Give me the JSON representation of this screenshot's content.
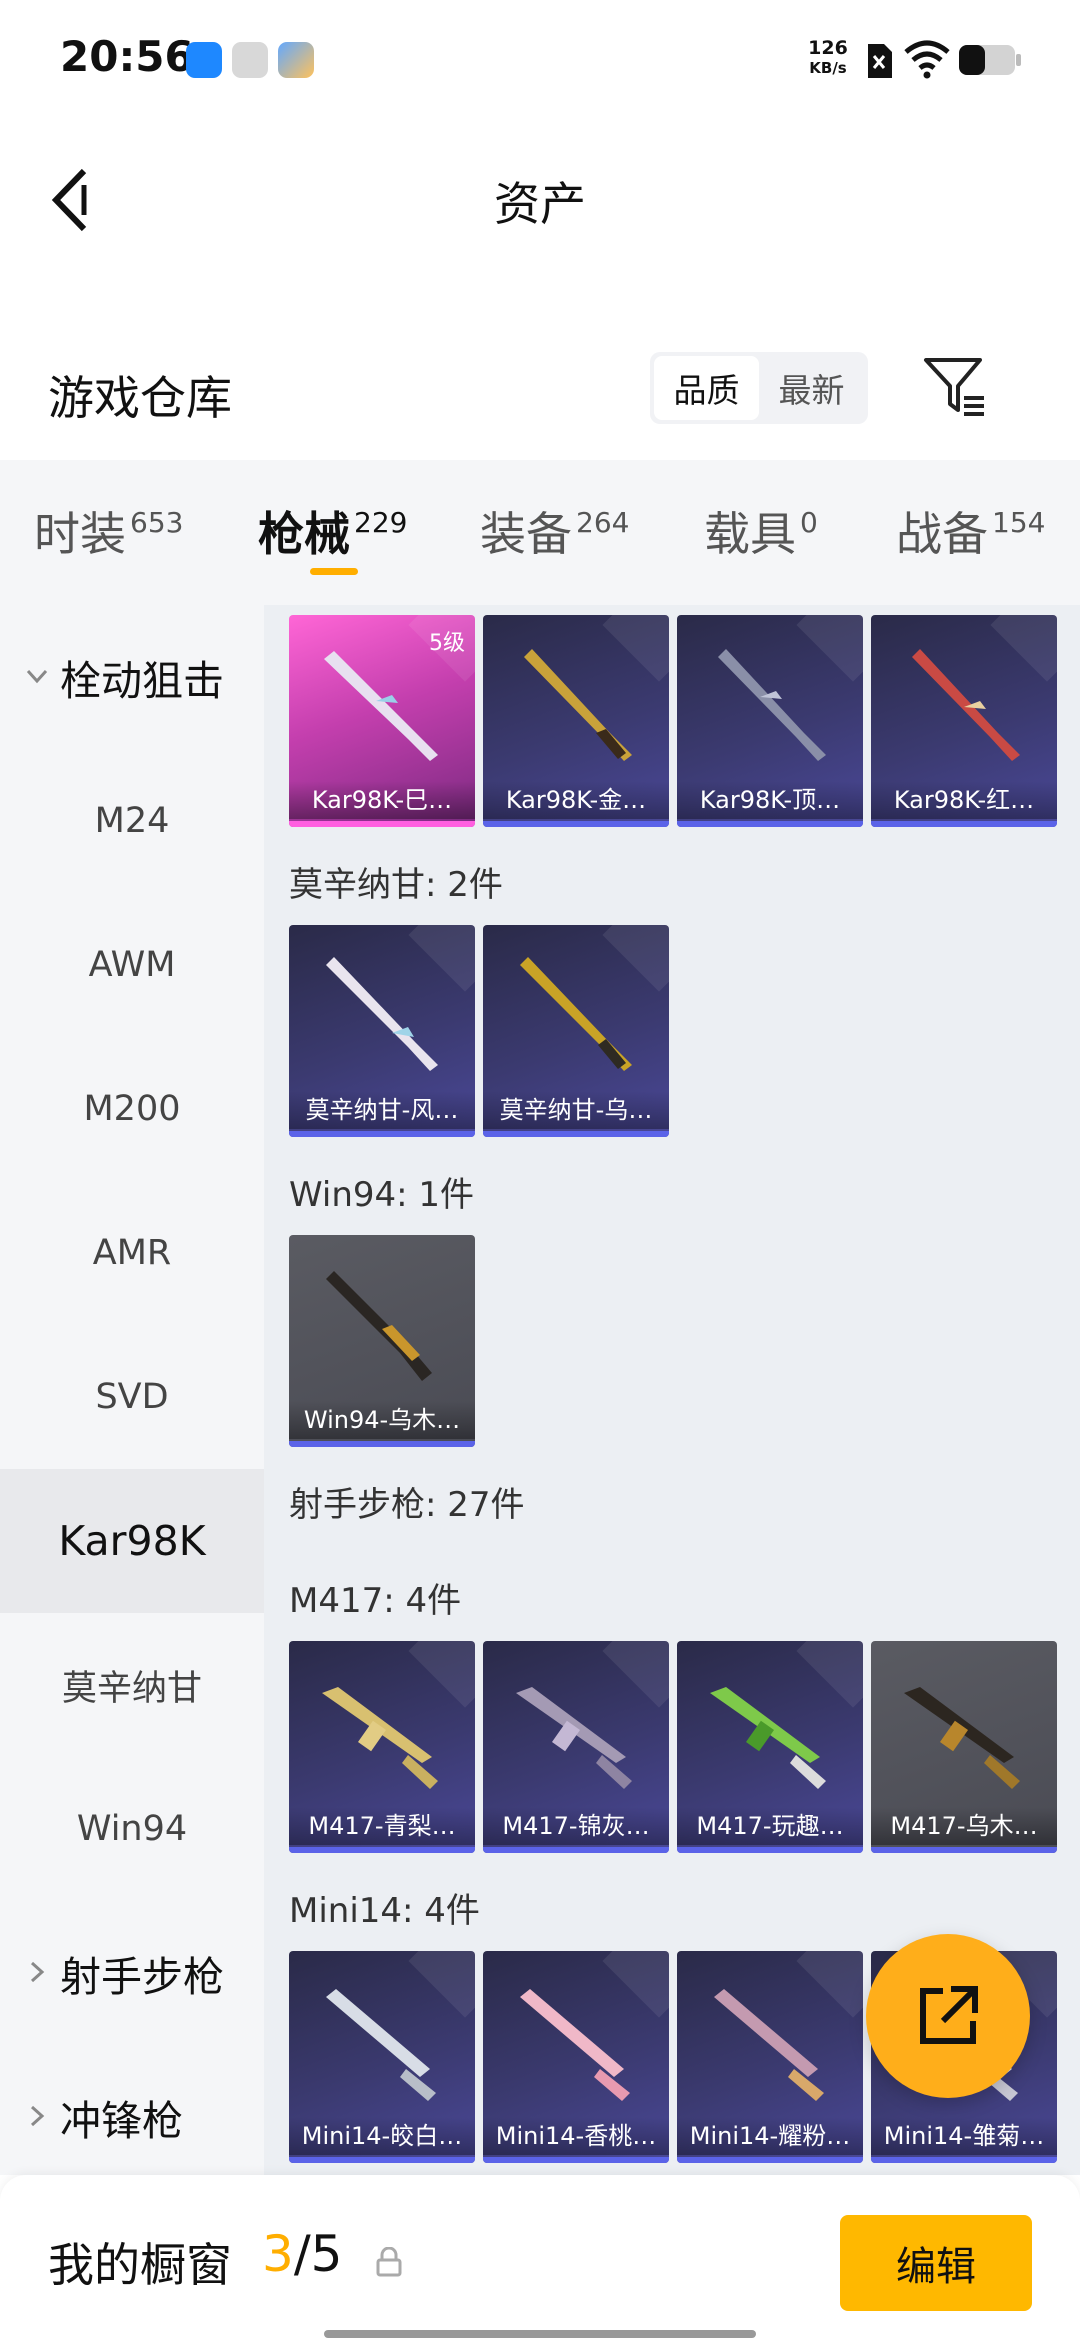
{
  "status": {
    "time": "20:56",
    "speed_value": "126",
    "speed_unit": "KB/s"
  },
  "header": {
    "title": "资产"
  },
  "section": {
    "title": "游戏仓库",
    "sort": [
      "品质",
      "最新"
    ]
  },
  "tabs": [
    {
      "label": "时装",
      "count": "653"
    },
    {
      "label": "枪械",
      "count": "229"
    },
    {
      "label": "装备",
      "count": "264"
    },
    {
      "label": "载具",
      "count": "0"
    },
    {
      "label": "战备",
      "count": "154"
    }
  ],
  "side_menu": {
    "group1": "栓动狙击",
    "items": [
      "M24",
      "AWM",
      "M200",
      "AMR",
      "SVD",
      "Kar98K",
      "莫辛纳甘",
      "Win94"
    ],
    "group2": "射手步枪",
    "group3": "冲锋枪"
  },
  "content": {
    "kar98k_cards": [
      {
        "label": "Kar98K-巳…",
        "badge": "5级"
      },
      {
        "label": "Kar98K-金…"
      },
      {
        "label": "Kar98K-顶…"
      },
      {
        "label": "Kar98K-红…"
      }
    ],
    "mosin_header": "莫辛纳甘: 2件",
    "mosin_cards": [
      {
        "label": "莫辛纳甘-风…"
      },
      {
        "label": "莫辛纳甘-乌…"
      }
    ],
    "win94_header": "Win94: 1件",
    "win94_cards": [
      {
        "label": "Win94-乌木…"
      }
    ],
    "dmr_header": "射手步枪: 27件",
    "m417_header": "M417: 4件",
    "m417_cards": [
      {
        "label": "M417-青梨…"
      },
      {
        "label": "M417-锦灰…"
      },
      {
        "label": "M417-玩趣…"
      },
      {
        "label": "M417-乌木…"
      }
    ],
    "mini14_header": "Mini14: 4件",
    "mini14_cards": [
      {
        "label": "Mini14-皎白…"
      },
      {
        "label": "Mini14-香桃…"
      },
      {
        "label": "Mini14-耀粉…"
      },
      {
        "label": "Mini14-雏菊…"
      }
    ]
  },
  "bottom": {
    "showcase_title": "我的橱窗",
    "used": "3",
    "total": "/5",
    "edit": "编辑"
  },
  "colors": {
    "accent": "#ffae00",
    "card_bg": "#3b3a70",
    "card_underline": "#5b63e8"
  }
}
